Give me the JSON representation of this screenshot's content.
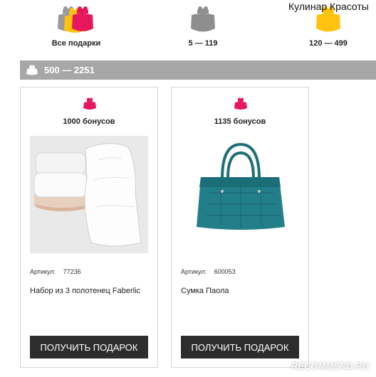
{
  "page": {
    "heading": "Кулинар Красоты"
  },
  "filters": [
    {
      "label": "Все подарки",
      "icon": "stacked-purses-icon",
      "colors": [
        "#9a9a9a",
        "#ffc20e",
        "#e6175c"
      ]
    },
    {
      "label": "5 — 119",
      "icon": "gray-purse-icon",
      "color": "#8e8e8e"
    },
    {
      "label": "120 — 499",
      "icon": "yellow-purse-icon",
      "color": "#ffc20e"
    }
  ],
  "range_bar": {
    "label": "500 — 2251",
    "icon": "purse-icon",
    "background": "#a7a7a7"
  },
  "products": [
    {
      "bonus": "1000 бонусов",
      "article_label": "Артикул:",
      "article": "77236",
      "name": "Набор из 3 полотенец Faberlic",
      "button": "ПОЛУЧИТЬ ПОДАРОК",
      "image": "towels-image"
    },
    {
      "bonus": "1135 бонусов",
      "article_label": "Артикул:",
      "article": "600053",
      "name": "Сумка Паола",
      "button": "ПОЛУЧИТЬ ПОДАРОК",
      "image": "teal-handbag-image"
    }
  ],
  "colors": {
    "accent_pink": "#e6175c",
    "button_bg": "#2d2d2d"
  },
  "watermark": {
    "text": "RECOMMEND.RU"
  }
}
